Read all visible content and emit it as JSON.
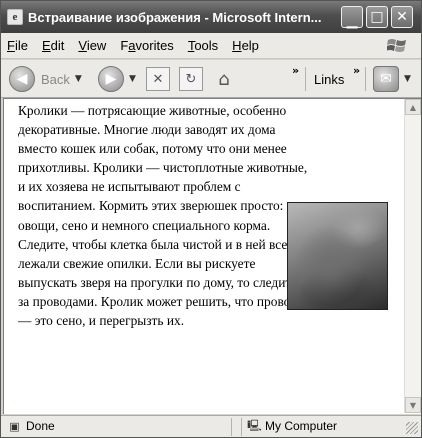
{
  "window": {
    "title": "Встраивание изображения - Microsoft Intern..."
  },
  "menu": {
    "items": [
      {
        "accel": "F",
        "rest": "ile"
      },
      {
        "accel": "E",
        "rest": "dit"
      },
      {
        "accel": "V",
        "rest": "iew"
      },
      {
        "prefix": "F",
        "accel": "a",
        "rest": "vorites"
      },
      {
        "accel": "T",
        "rest": "ools"
      },
      {
        "accel": "H",
        "rest": "elp"
      }
    ]
  },
  "toolbar": {
    "back_label": "Back",
    "links_label": "Links",
    "chevron": "»",
    "icons": [
      "back-icon",
      "forward-icon",
      "stop-icon",
      "refresh-icon",
      "home-icon",
      "messenger-icon"
    ]
  },
  "content": {
    "paragraph": "Кролики — потрясающие животные, особенно декоративные. Многие люди заводят их дома вместо кошек или собак, потому что они менее прихотливы. Кролики — чистоплотные животные, и их хозяева не испытывают проблем с воспитанием. Кормить этих зверюшек просто: овощи, сено и немного специального корма. Следите, чтобы клетка была чистой и в ней всегда лежали свежие опилки. Если вы рискуете выпускать зверя на прогулки по дому, то следите за проводами. Кролик может решить, что провода — это сено, и перегрызть их."
  },
  "status": {
    "left_text": "Done",
    "zone_text": "My Computer"
  }
}
